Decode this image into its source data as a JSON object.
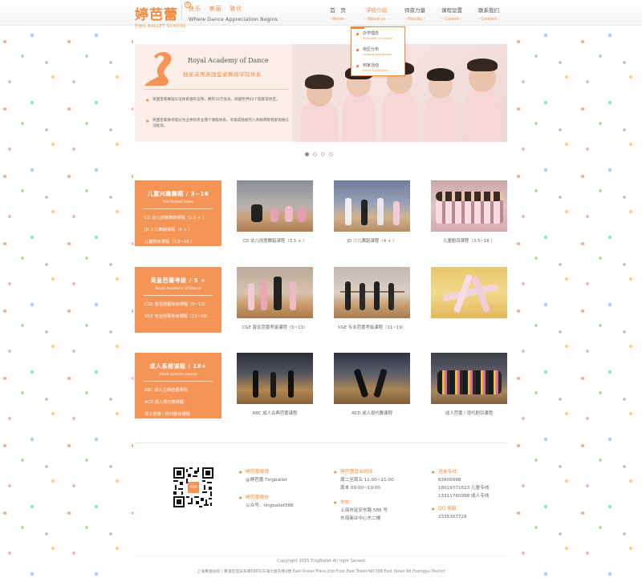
{
  "brand": {
    "logo_cn": "婷芭蕾",
    "logo_en": "TING BALLET SCHOOL",
    "slogan_cn": "快乐 · 美丽 · 致优",
    "slogan_en": "Where Dance Appreciation Begins",
    "accent": "#f08a3c"
  },
  "nav": [
    {
      "cn": "首　页",
      "en": "- Home -"
    },
    {
      "cn": "学校介绍",
      "en": "- About us -"
    },
    {
      "cn": "师资力量",
      "en": "- Faculty -"
    },
    {
      "cn": "课程设置",
      "en": "- Course -"
    },
    {
      "cn": "联系我们",
      "en": "- Contact -"
    }
  ],
  "dropdown": [
    {
      "cn": "办学理念",
      "en": "Philosophy of school"
    },
    {
      "cn": "校区分布",
      "en": "Campus distribution"
    },
    {
      "cn": "到家活动",
      "en": "Event & activities"
    }
  ],
  "banner": {
    "title": "Royal Academy of Dance",
    "subtitle": "独家采用英国皇家舞蹈学院体系",
    "para1": "英国皇家舞蹈认证体系遍布全球，拥有16万会员，跨越世界82个国家及地区。",
    "para2": "英国皇家舞考级分为业余和专业两个课程体系，考级成绩被列入英联邦教育部资格认证框架。"
  },
  "categories": [
    {
      "title": "儿童兴趣舞蹈 / 3~16",
      "en": "Pre-School Class",
      "links": [
        "CD 幼儿创意舞蹈课程（3.5 + ）",
        "JD 少儿舞蹈课程（4 + ）",
        "儿童剧目课程（3.5~16 ）"
      ],
      "captions": [
        "CD 幼儿创意舞蹈课程（3.5 + ）",
        "JD 少儿舞蹈课程（4 + ）",
        "儿童剧目课程（3.5~16 ）"
      ]
    },
    {
      "title": "英皇芭蕾考级 / 5 +",
      "en": "Royal Academy of Dance",
      "links": [
        "CGE 普及芭蕾考级课程（5~13）",
        "VGE 专业芭蕾考级课程（11~19）"
      ],
      "captions": [
        "CGE 普及芭蕾考级课程（5~13）",
        "VGE 专业芭蕾考级课程（11~19）"
      ]
    },
    {
      "title": "成人系统课程 / 18+",
      "en": "Adult system course",
      "links": [
        "ABC 成人古典芭蕾课程",
        "ACD 成人现代舞课程",
        "成人芭蕾 / 现代剧目课程"
      ],
      "captions": [
        "ABC 成人古典芭蕾课程",
        "ACD 成人现代舞课程",
        "成人芭蕾 / 现代剧目课程"
      ]
    }
  ],
  "footer": {
    "weibo_head": "婷芭蕾微博",
    "weibo_val": "@婷芭蕾 Tingballet",
    "wechat_head": "婷芭蕾微信",
    "wechat_val": "公众号：tingballet588",
    "hours_head": "婷芭蕾营业时间：",
    "hours_1": "周二至周五 11:00~21:00",
    "hours_2": "周末 09:00~19:00",
    "addr_head": "地址：",
    "addr_1": "上海市延安东路 588 号",
    "addr_2": "东海商业中心东二楼",
    "phone_head": "咨询专线：",
    "phone_1": "63600998",
    "phone_2": "18019371823 儿童专线",
    "phone_3": "13311760998 成人专线",
    "qq_head": "QQ 客服：",
    "qq_val": "2335307729",
    "qr_label": "婷芭蕾"
  },
  "copyright_1": "Copyright 2015 TingBallet All right Served",
  "copyright_2": "上海黄浦总校 | 黄浦区延安东路588号东海大厦东楼2楼  East Ocean Place,2nd Floor,East Tower,NO.588 East Yanan Rd,Huangpu District"
}
